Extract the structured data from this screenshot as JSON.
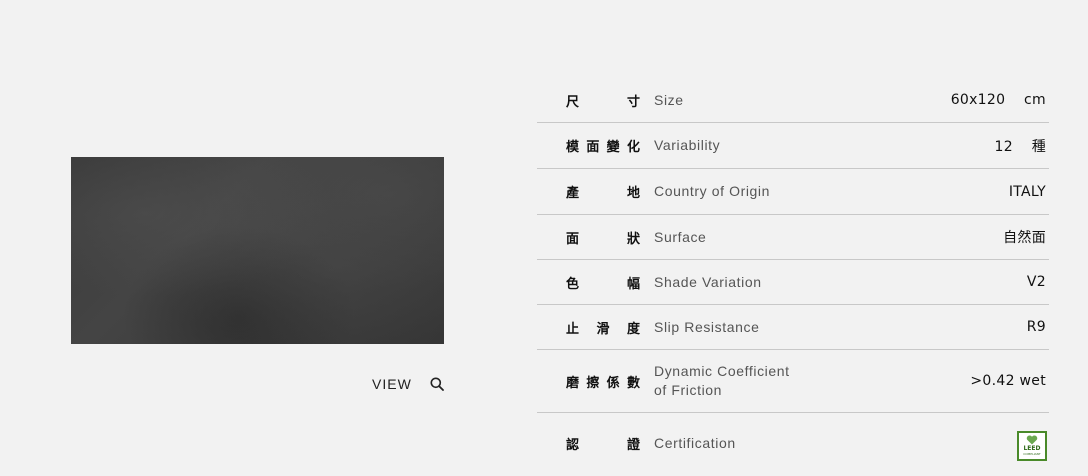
{
  "view": {
    "label": "VIEW",
    "icon": "search-icon"
  },
  "specs": [
    {
      "zh": [
        "尺",
        "寸"
      ],
      "en": "Size",
      "value": "60x120  cm"
    },
    {
      "zh": [
        "模",
        "面",
        "變",
        "化"
      ],
      "en": "Variability",
      "value": "12  種"
    },
    {
      "zh": [
        "產",
        "地"
      ],
      "en": "Country of Origin",
      "value": "ITALY"
    },
    {
      "zh": [
        "面",
        "狀"
      ],
      "en": "Surface",
      "value": "自然面"
    },
    {
      "zh": [
        "色",
        "幅"
      ],
      "en": "Shade Variation",
      "value": "V2"
    },
    {
      "zh": [
        "止",
        "滑",
        "度"
      ],
      "en": "Slip Resistance",
      "value": "R9"
    },
    {
      "zh": [
        "磨",
        "擦",
        "係",
        "數"
      ],
      "en": "Dynamic Coefficient\nof Friction",
      "value": ">0.42 wet"
    },
    {
      "zh": [
        "認",
        "證"
      ],
      "en": "Certification",
      "value": "",
      "badge": {
        "icon": "leed-heart-icon",
        "text": "LEED",
        "sub": "COMPLIANT"
      }
    }
  ],
  "colors": {
    "background": "#f2f2f2",
    "leed_green": "#4a8a2a"
  }
}
